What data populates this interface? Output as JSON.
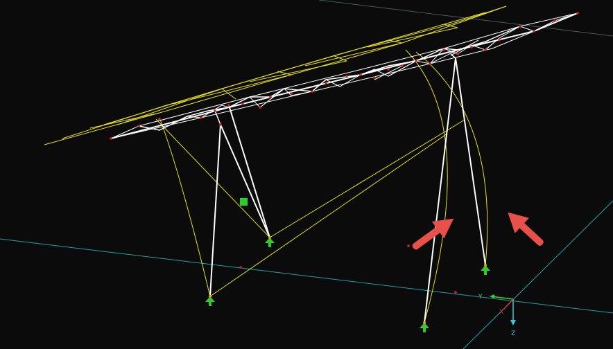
{
  "colors": {
    "background": "#0b0b0b",
    "grid_line": "#1f9fa6",
    "grid_faint": "#5a6e70",
    "deformed": "#e8e21a",
    "members": "#ffffff",
    "nodes": "#e02020",
    "supports": "#2ecc2e",
    "arrows": "#e8504a",
    "axis_y": "#3ad63a",
    "axis_z": "#3ac8d8",
    "axis_x": "#d83a3a"
  },
  "axes": {
    "y_label": "Y",
    "z_label": "Z",
    "x_label": "X"
  },
  "icons": {
    "support": "fixed-support-icon",
    "arrow": "highlight-arrow-icon",
    "load": "load-marker-icon"
  }
}
